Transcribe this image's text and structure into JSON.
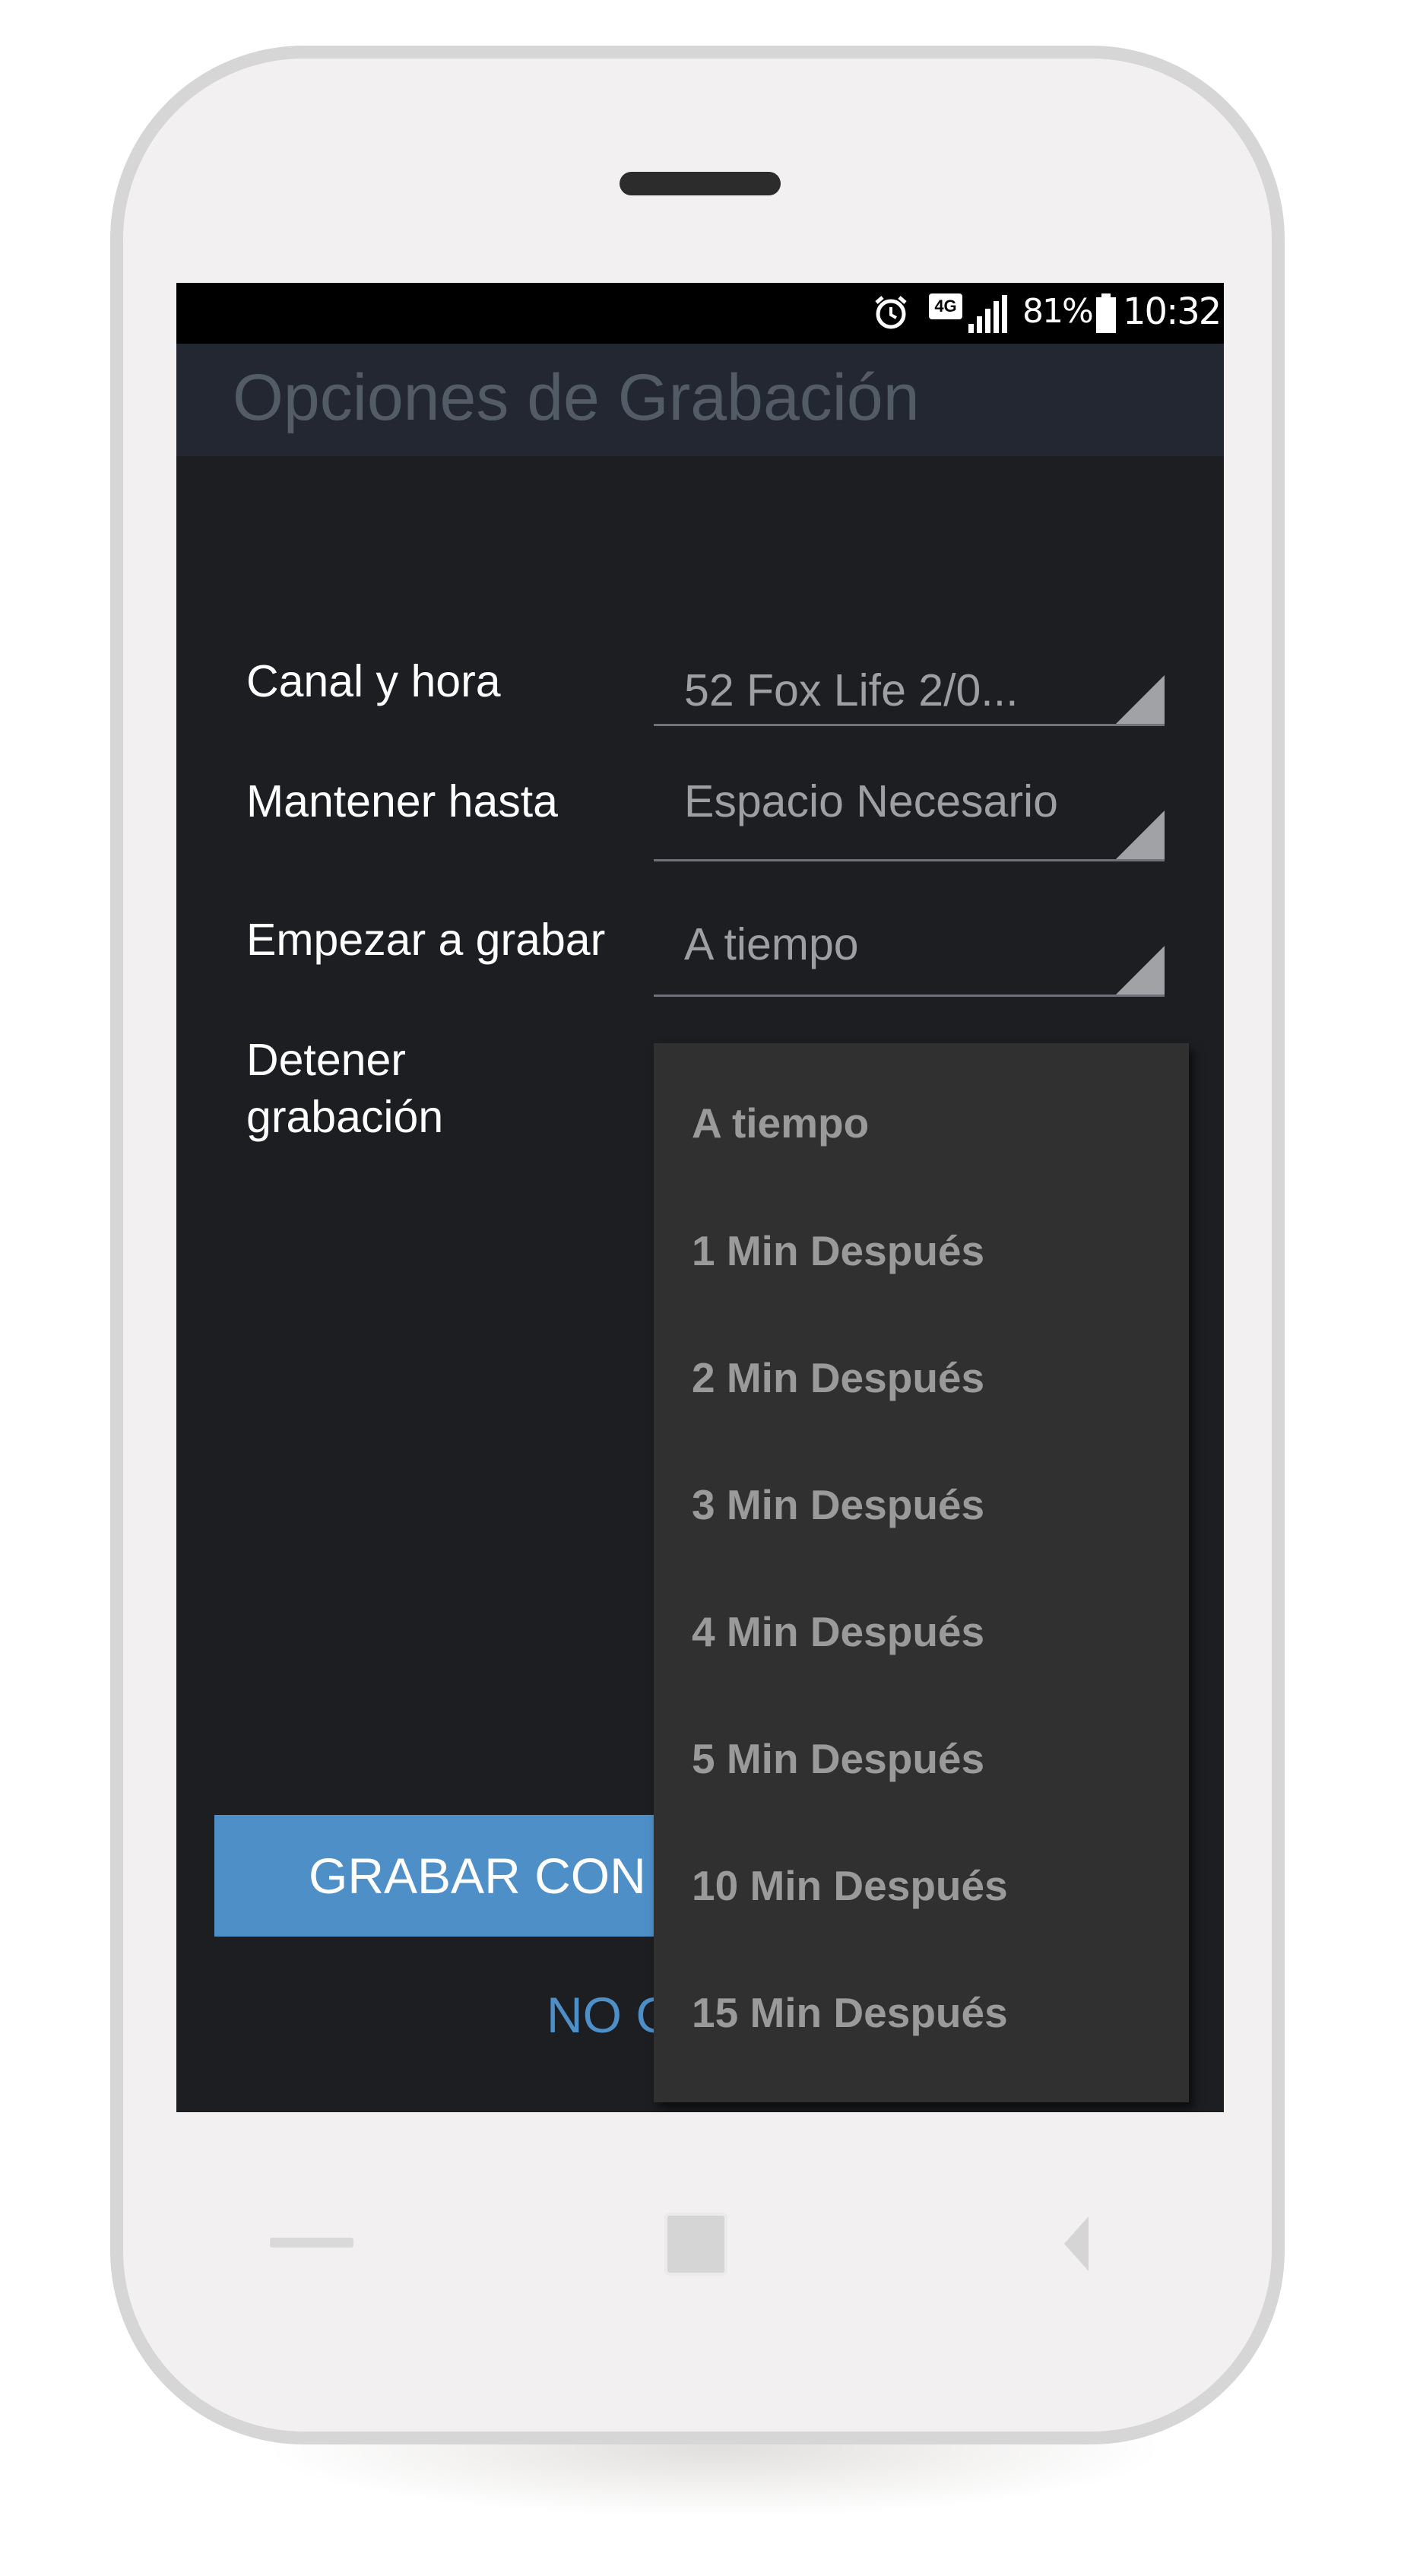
{
  "status_bar": {
    "network_badge": "4G",
    "battery_percent": "81%",
    "time": "10:32",
    "icons": [
      "alarm-clock-icon",
      "mobile-data-icon",
      "signal-icon",
      "battery-icon"
    ]
  },
  "app_bar": {
    "title": "Opciones de Grabación"
  },
  "form": {
    "rows": [
      {
        "label": "Canal y hora",
        "value": "52 Fox Life 2/0..."
      },
      {
        "label": "Mantener hasta",
        "value": "Espacio Necesario"
      },
      {
        "label": "Empezar a grabar",
        "value": "A tiempo"
      },
      {
        "label": "Detener grabación",
        "label_line1": "Detener",
        "label_line2": "grabación"
      }
    ]
  },
  "dropdown": {
    "options": [
      "A tiempo",
      "1 Min Después",
      "2 Min Después",
      "3 Min Después",
      "4 Min Después",
      "5 Min Después",
      "10 Min Después",
      "15 Min Después"
    ]
  },
  "actions": {
    "record_button_visible": "GRABAR CON",
    "cancel_link_visible": "NO C"
  },
  "nav_bar": {
    "icons": [
      "back-line-icon",
      "home-square-icon",
      "back-triangle-icon"
    ]
  },
  "colors": {
    "screen_bg": "#1c1e22",
    "app_bar_bg": "#222732",
    "accent": "#4e8fc7",
    "dropdown_bg": "#303030",
    "device_frame": "#d6d6d6"
  }
}
